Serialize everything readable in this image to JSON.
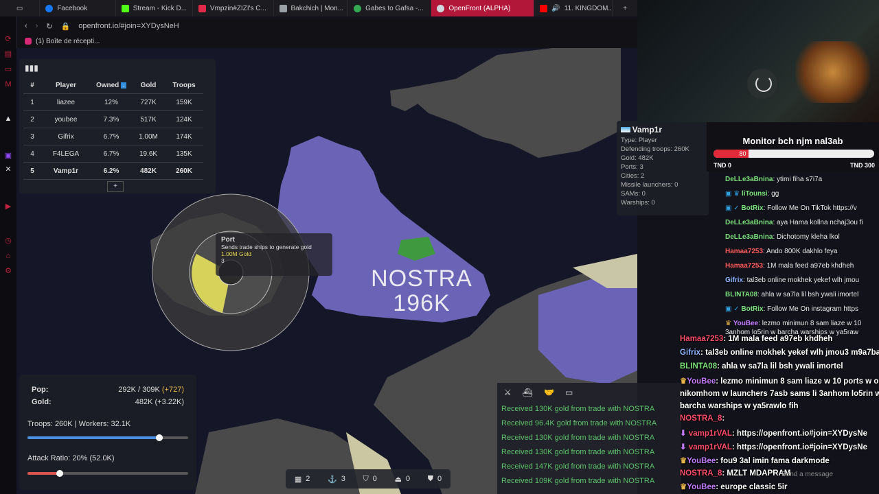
{
  "browser": {
    "tabs": [
      {
        "label": "Facebook",
        "color": "#1877f2",
        "active": false
      },
      {
        "label": "Stream - Kick D...",
        "color": "#53fc18",
        "active": false
      },
      {
        "label": "Vmpzin#ZIZI's C...",
        "color": "#e02a4a",
        "active": false
      },
      {
        "label": "Bakchich | Mon...",
        "color": "#9aa0a6",
        "active": false
      },
      {
        "label": "Gabes to Gafsa -...",
        "color": "#34a853",
        "active": false
      },
      {
        "label": "OpenFront (ALPHA)",
        "color": "#cfd8dc",
        "active": true
      },
      {
        "label": "11. KINGDOM...",
        "color": "#ff0000",
        "active": false
      }
    ],
    "new_tab": "+",
    "url": "openfront.io/#join=XYDysNeH",
    "bookmark": "(1) Boîte de récepti..."
  },
  "leaderboard": {
    "headers": [
      "#",
      "Player",
      "Owned",
      "Gold",
      "Troops"
    ],
    "rows": [
      [
        "1",
        "liazee",
        "12%",
        "727K",
        "159K"
      ],
      [
        "2",
        "youbee",
        "7.3%",
        "517K",
        "124K"
      ],
      [
        "3",
        "Gifrix",
        "6.7%",
        "1.00M",
        "174K"
      ],
      [
        "4",
        "F4LEGA",
        "6.7%",
        "19.6K",
        "135K"
      ],
      [
        "5",
        "Vamp1r",
        "6.2%",
        "482K",
        "260K"
      ]
    ],
    "expand": "+"
  },
  "map": {
    "player_label": "NOSTRA",
    "player_troops": "196K"
  },
  "player_panel": {
    "name": "Vamp1r",
    "type": "Type: Player",
    "defending": "Defending troops: 260K",
    "gold": "Gold: 482K",
    "ports": "Ports: 3",
    "cities": "Cities: 2",
    "missiles": "Missile launchers: 0",
    "sams": "SAMs: 0",
    "warships": "Warships: 0"
  },
  "port_tooltip": {
    "title": "Port",
    "desc": "Sends trade ships to generate gold",
    "cost": "1.00M Gold",
    "count": "3"
  },
  "stats": {
    "pop_label": "Pop:",
    "pop_value": "292K / 309K",
    "pop_delta": "(+727)",
    "gold_label": "Gold:",
    "gold_value": "482K (+3.22K)",
    "troops_workers": "Troops: 260K | Workers: 32.1K",
    "troops_ratio": 0.82,
    "attack_ratio": "Attack Ratio: 20% (52.0K)",
    "attack_fraction": 0.2
  },
  "build_bar": [
    {
      "icon": "city-icon",
      "count": "2"
    },
    {
      "icon": "anchor-icon",
      "count": "3"
    },
    {
      "icon": "shield-icon",
      "count": "0"
    },
    {
      "icon": "missile-icon",
      "count": "0"
    },
    {
      "icon": "sam-icon",
      "count": "0"
    }
  ],
  "event_log": [
    "Received 130K gold from trade with NOSTRA",
    "Received 96.4K gold from trade with NOSTRA",
    "Received 130K gold from trade with NOSTRA",
    "Received 130K gold from trade with NOSTRA",
    "Received 147K gold from trade with NOSTRA",
    "Received 109K gold from trade with NOSTRA"
  ],
  "poll": {
    "title": "Monitor bch njm nal3ab",
    "value": "80",
    "fraction": 0.22,
    "left_label": "TND 0",
    "right_label": "TND 300"
  },
  "chat": [
    {
      "user": "DeLLe3aBnina",
      "color": "#7be07b",
      "text": ": ytimi fiha s7i7a"
    },
    {
      "user": "liTounsi",
      "color": "#7be07b",
      "text": ": gg"
    },
    {
      "user": "BotRix",
      "color": "#7be07b",
      "text": ": Follow Me On TikTok https://v"
    },
    {
      "user": "DeLLe3aBnina",
      "color": "#7be07b",
      "text": ": aya Hama kollna nchaj3ou fi"
    },
    {
      "user": "DeLLe3aBnina",
      "color": "#7be07b",
      "text": ": Dichotomy kleha lkol"
    },
    {
      "user": "Hamaa7253",
      "color": "#ff5a5a",
      "text": ": Ando 800K dakhlo feya"
    },
    {
      "user": "Hamaa7253",
      "color": "#ff5a5a",
      "text": ": 1M mala feed a97eb khdheh"
    },
    {
      "user": "Gifrix",
      "color": "#8fb4ff",
      "text": ": tal3eb online mokhek yekef wlh jmou"
    },
    {
      "user": "BLINTA08",
      "color": "#7be07b",
      "text": ": ahla w sa7la lil bsh ywali imortel"
    },
    {
      "user": "BotRix",
      "color": "#7be07b",
      "text": ": Follow Me On instagram https"
    },
    {
      "user": "YouBee",
      "color": "#c27bff",
      "text": ": lezmo minimun 8 sam liaze w 10"
    }
  ],
  "chat_wrap": "3anhom lo5rin w barcha warships w ya5raw",
  "overlay_chat": [
    {
      "user": "Hamaa7253",
      "color": "#ff4d6a",
      "text": ": 1M mala feed a97eb khdheh"
    },
    {
      "user": "Gifrix",
      "color": "#8fb4ff",
      "text": ": tal3eb online mokhek yekef wlh jmou3 m9a7ba"
    },
    {
      "user": "BLINTA08",
      "color": "#7be07b",
      "text": ": ahla w sa7la lil bsh ywali imortel"
    },
    {
      "user": "YouBee",
      "color": "#c27bff",
      "text": ": lezmo minimun 8 sam liaze w 10 ports w o"
    },
    {
      "user": "",
      "color": "#ffffff",
      "text": "nikomhom w launchers 7asb sams li 3anhom lo5rin w"
    },
    {
      "user": "",
      "color": "#ffffff",
      "text": "barcha warships w ya5rawlo fih"
    },
    {
      "user": "NOSTRA_8",
      "color": "#ff4d6a",
      "text": ":"
    },
    {
      "user": "vamp1rVAL",
      "color": "#ff4d6a",
      "text": ": https://openfront.io#join=XYDysNe"
    },
    {
      "user": "vamp1rVAL",
      "color": "#ff4d6a",
      "text": ": https://openfront.io#join=XYDysNe"
    },
    {
      "user": "YouBee",
      "color": "#c27bff",
      "text": ": fou9 3al imin fama darkmode"
    },
    {
      "user": "NOSTRA_8",
      "color": "#ff4d6a",
      "text": ": MZLT MDAPRAM"
    },
    {
      "user": "YouBee",
      "color": "#c27bff",
      "text": ": europe classic 5ir"
    }
  ],
  "chat_placeholder": "Send a message"
}
